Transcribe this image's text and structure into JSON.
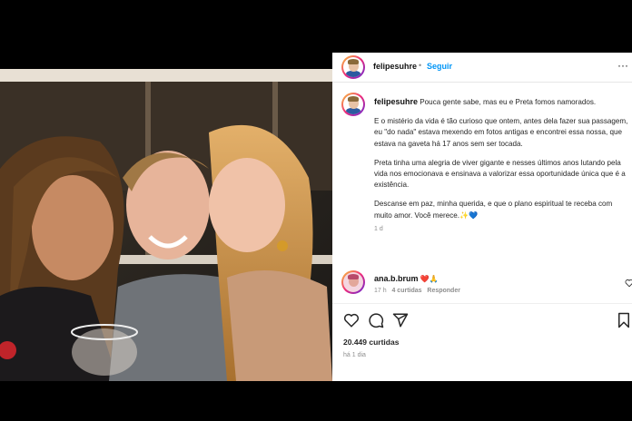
{
  "post": {
    "username": "felipesuhre",
    "follow_label": "Seguir",
    "separator": "•",
    "more_label": "···",
    "caption_paragraphs": [
      "Pouca gente sabe, mas eu e Preta fomos namorados.",
      "E o mistério da vida é tão curioso que ontem, antes dela fazer sua passagem, eu \"do nada\" estava mexendo em fotos antigas e encontrei essa nossa, que estava na gaveta há 17 anos sem ser tocada.",
      "Preta tinha uma alegria de viver gigante e nesses últimos anos lutando pela vida nos emocionava e ensinava a valorizar essa oportunidade única que é a existência.",
      "Descanse em paz, minha querida, e que o plano espiritual te receba com muito amor. Você merece.✨💙"
    ],
    "caption_age": "1 d",
    "comment": {
      "username": "ana.b.brum",
      "text": "❤️🙏",
      "age": "17 h",
      "likes": "4 curtidas",
      "reply_label": "Responder"
    },
    "likes_count": "20.449 curtidas",
    "date": "há 1 dia"
  },
  "icons": [
    "heart-icon",
    "comment-icon",
    "share-icon",
    "bookmark-icon",
    "more-icon"
  ],
  "colors": {
    "background": "#000000",
    "link": "#0095f6",
    "text": "#262626",
    "muted": "#8e8e8e"
  }
}
